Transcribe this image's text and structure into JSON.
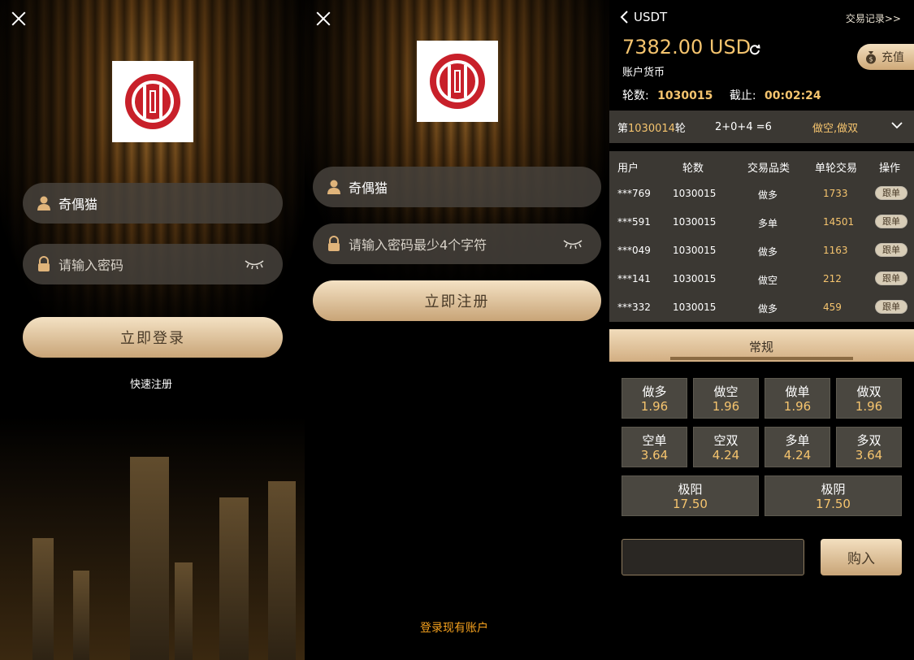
{
  "login": {
    "username_value": "奇偶猫",
    "password_placeholder": "请输入密码",
    "login_button": "立即登录",
    "register_link": "快速注册"
  },
  "register": {
    "username_value": "奇偶猫",
    "password_placeholder": "请输入密码最少4个字符",
    "register_button": "立即注册",
    "existing_account_link": "登录现有账户"
  },
  "trade": {
    "header_title": "USDT",
    "records_link": "交易记录>>",
    "balance": "7382.00 USD",
    "account_label": "账户货币",
    "recharge_label": "充值",
    "round_label": "轮数:",
    "round_value": "1030015",
    "deadline_label": "截止:",
    "deadline_value": "00:02:24",
    "last_round": {
      "prefix": "第",
      "number": "1030014",
      "suffix": "轮",
      "equation": "2+0+4 =6",
      "result": "做空,做双"
    },
    "table_headers": [
      "用户",
      "轮数",
      "交易品类",
      "单轮交易",
      "操作"
    ],
    "rows": [
      {
        "user": "***769",
        "round": "1030015",
        "type": "做多",
        "amount": "1733",
        "action": "跟单"
      },
      {
        "user": "***591",
        "round": "1030015",
        "type": "多单",
        "amount": "14501",
        "action": "跟单"
      },
      {
        "user": "***049",
        "round": "1030015",
        "type": "做多",
        "amount": "1163",
        "action": "跟单"
      },
      {
        "user": "***141",
        "round": "1030015",
        "type": "做空",
        "amount": "212",
        "action": "跟单"
      },
      {
        "user": "***332",
        "round": "1030015",
        "type": "做多",
        "amount": "459",
        "action": "跟单"
      }
    ],
    "tab_label": "常规",
    "options": [
      {
        "name": "做多",
        "odds": "1.96"
      },
      {
        "name": "做空",
        "odds": "1.96"
      },
      {
        "name": "做单",
        "odds": "1.96"
      },
      {
        "name": "做双",
        "odds": "1.96"
      },
      {
        "name": "空单",
        "odds": "3.64"
      },
      {
        "name": "空双",
        "odds": "4.24"
      },
      {
        "name": "多单",
        "odds": "4.24"
      },
      {
        "name": "多双",
        "odds": "3.64"
      },
      {
        "name": "极阳",
        "odds": "17.50"
      },
      {
        "name": "极阴",
        "odds": "17.50"
      }
    ],
    "buy_button": "购入"
  },
  "colors": {
    "gold": "#f5c46e",
    "orange_link": "#f6a21e",
    "panel_gray": "#3b3833",
    "brand_red": "#c8202a"
  }
}
